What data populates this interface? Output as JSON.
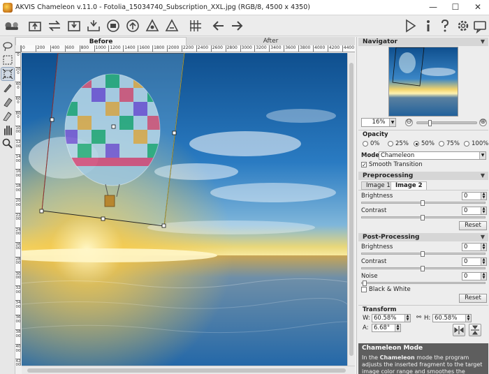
{
  "window": {
    "title": "AKVIS Chameleon v.11.0 - Fotolia_15034740_Subscription_XXL.jpg (RGB/8, 4500 x 4350)"
  },
  "toolbar": {
    "left_icons": [
      "home-icon",
      "open-icon",
      "swap-icon",
      "save-icon",
      "export-icon",
      "print-icon",
      "share-icon",
      "fragment-icon",
      "fragment-alt-icon",
      "grid-icon",
      "undo-icon",
      "redo-icon"
    ],
    "right_icons": [
      "run-icon",
      "info-icon",
      "help-icon",
      "settings-icon",
      "feedback-icon"
    ]
  },
  "tools": [
    "selection-lasso-icon",
    "rectangle-select-icon",
    "transform-icon",
    "brush-icon",
    "eraser-icon",
    "pencil-eraser-icon",
    "hand-icon",
    "zoom-icon"
  ],
  "tabs": {
    "before": "Before",
    "after": "After"
  },
  "ruler": {
    "h_ticks": [
      "0",
      "200",
      "400",
      "600",
      "800",
      "1000",
      "1200",
      "1400",
      "1600",
      "1800",
      "2000",
      "2200",
      "2400",
      "2600",
      "2800",
      "3000",
      "3200",
      "3400",
      "3600",
      "3800",
      "4000",
      "4200",
      "4400"
    ],
    "v_ticks": [
      "0",
      "200",
      "400",
      "600",
      "800",
      "1000",
      "1200",
      "1400",
      "1600",
      "1800",
      "2000",
      "2200",
      "2400",
      "2600",
      "2800",
      "3000",
      "3200",
      "3400",
      "3600",
      "3800",
      "4000",
      "4200"
    ]
  },
  "navigator": {
    "title": "Navigator",
    "zoom": "16%",
    "minus": "⊖",
    "plus": "⊕",
    "zoom_level": 0.2
  },
  "opacity": {
    "title": "Opacity",
    "options": [
      "0%",
      "25%",
      "50%",
      "75%",
      "100%"
    ],
    "selected": "50%"
  },
  "mode": {
    "label": "Mode",
    "value": "Chameleon"
  },
  "smooth": {
    "label": "Smooth Transition",
    "checked": true
  },
  "preprocessing": {
    "title": "Preprocessing",
    "tabs": [
      "Image 1",
      "Image 2"
    ],
    "active_tab": "Image 2",
    "brightness_label": "Brightness",
    "brightness": "0",
    "contrast_label": "Contrast",
    "contrast": "0",
    "reset": "Reset"
  },
  "postprocessing": {
    "title": "Post-Processing",
    "brightness_label": "Brightness",
    "brightness": "0",
    "contrast_label": "Contrast",
    "contrast": "0",
    "noise_label": "Noise",
    "noise": "0",
    "bw_label": "Black & White",
    "reset": "Reset"
  },
  "transform": {
    "title": "Transform",
    "w_label": "W:",
    "w": "60.58%",
    "h_label": "H:",
    "h": "60.58%",
    "a_label": "A:",
    "a": "6.68°"
  },
  "help": {
    "title": "Chameleon Mode",
    "body_prefix": "In the ",
    "body_bold": "Chameleon",
    "body_suffix": " mode the program adjusts the inserted fragment to the target image color range and smoothes the fragment's borders."
  },
  "colors": {
    "panel": "#ededed",
    "help_bg": "#5e5e5e",
    "sky": "#1b5f9b"
  }
}
